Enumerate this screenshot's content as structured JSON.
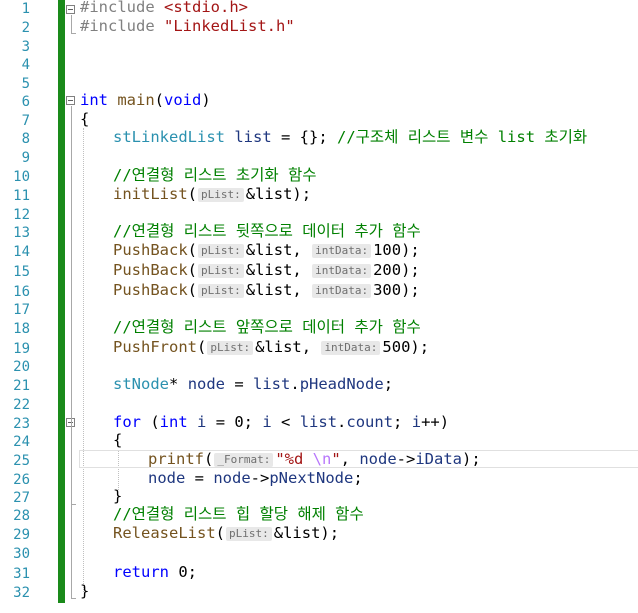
{
  "line_numbers": [
    "1",
    "2",
    "3",
    "4",
    "5",
    "6",
    "7",
    "8",
    "9",
    "10",
    "11",
    "12",
    "13",
    "14",
    "15",
    "16",
    "17",
    "18",
    "19",
    "20",
    "21",
    "22",
    "23",
    "24",
    "25",
    "26",
    "27",
    "28",
    "29",
    "30",
    "31",
    "32"
  ],
  "code": {
    "l1": {
      "pp": "#include ",
      "header": "<stdio.h>"
    },
    "l2": {
      "pp": "#include ",
      "header": "\"LinkedList.h\""
    },
    "l6": {
      "kw1": "int",
      "fn": "main",
      "open": "(",
      "kw2": "void",
      "close": ")"
    },
    "l7": {
      "brace": "{"
    },
    "l8": {
      "type": "stLinkedList",
      "var": "list",
      "rest": " = {}; ",
      "comment": "//구조체 리스트 변수 list 초기화"
    },
    "l10": {
      "comment": "//연결형 리스트 초기화 함수"
    },
    "l11": {
      "fn": "initList",
      "open": "(",
      "hint": "pList:",
      "arg": "&list",
      "close": ");"
    },
    "l13": {
      "comment": "//연결형 리스트 뒷쪽으로 데이터 추가 함수"
    },
    "l14": {
      "fn": "PushBack",
      "open": "(",
      "hint1": "pList:",
      "arg1": "&list",
      "sep": ", ",
      "hint2": "intData:",
      "arg2": "100",
      "close": ");"
    },
    "l15": {
      "fn": "PushBack",
      "open": "(",
      "hint1": "pList:",
      "arg1": "&list",
      "sep": ", ",
      "hint2": "intData:",
      "arg2": "200",
      "close": ");"
    },
    "l16": {
      "fn": "PushBack",
      "open": "(",
      "hint1": "pList:",
      "arg1": "&list",
      "sep": ", ",
      "hint2": "intData:",
      "arg2": "300",
      "close": ");"
    },
    "l18": {
      "comment": "//연결형 리스트 앞쪽으로 데이터 추가 함수"
    },
    "l19": {
      "fn": "PushFront",
      "open": "(",
      "hint1": "pList:",
      "arg1": "&list",
      "sep": ", ",
      "hint2": "intData:",
      "arg2": "500",
      "close": ");"
    },
    "l21": {
      "type": "stNode",
      "star": "*",
      "sp": " ",
      "var": "node",
      "eq": " = ",
      "obj": "list",
      "dot": ".",
      "field": "pHeadNode",
      "end": ";"
    },
    "l23": {
      "kw1": "for",
      "p1": " (",
      "kw2": "int",
      "p2": " ",
      "i1": "i",
      "p3": " = 0; ",
      "i2": "i",
      "p4": " < ",
      "obj": "list",
      "dot": ".",
      "field": "count",
      "p5": "; ",
      "i3": "i",
      "p6": "++)"
    },
    "l24": {
      "brace": "{"
    },
    "l25": {
      "fn": "printf",
      "open": "(",
      "hint": "_Format:",
      "str1": "\"%d ",
      "esc": "\\n",
      "str2": "\"",
      "sep": ", ",
      "obj": "node",
      "arrow": "->",
      "field": "iData",
      "close": ");"
    },
    "l26": {
      "var1": "node",
      "eq": " = ",
      "obj": "node",
      "arrow": "->",
      "field": "pNextNode",
      "end": ";"
    },
    "l27": {
      "brace": "}"
    },
    "l28": {
      "comment": "//연결형 리스트 힙 할당 해제 함수"
    },
    "l29": {
      "fn": "ReleaseList",
      "open": "(",
      "hint": "pList:",
      "arg": "&list",
      "close": ");"
    },
    "l31": {
      "kw": "return",
      "rest": " 0;"
    },
    "l32": {
      "brace": "}"
    }
  },
  "colors": {
    "line_number": "#2b91af",
    "keyword": "#0000ff",
    "type": "#2b91af",
    "comment": "#008000",
    "string": "#a31515",
    "preprocessor": "#808080",
    "change_bar": "#1a8a1a"
  }
}
